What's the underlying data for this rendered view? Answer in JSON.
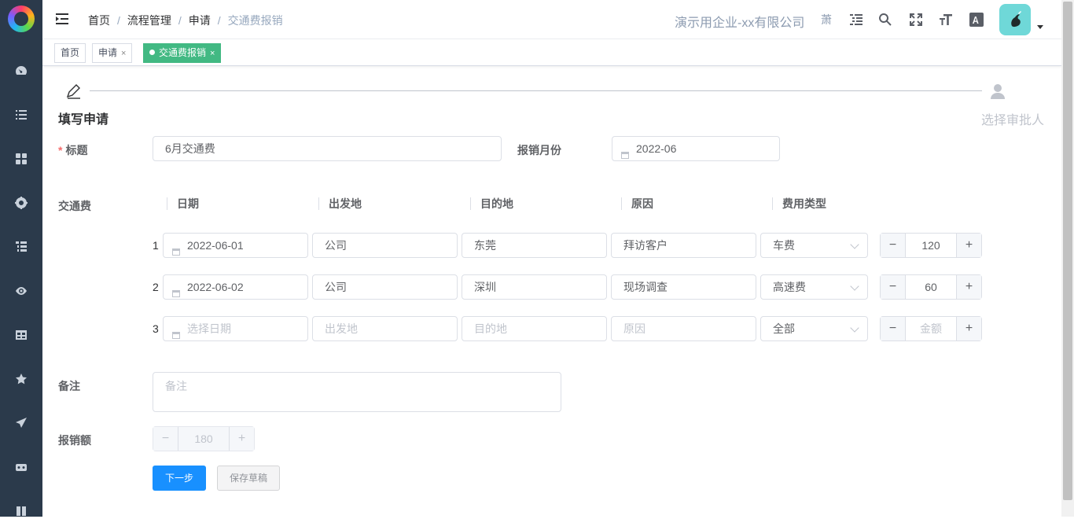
{
  "breadcrumb": [
    "首页",
    "流程管理",
    "申请",
    "交通费报销"
  ],
  "company": "演示用企业-xx有限公司",
  "header_lang": "萧",
  "tags": [
    {
      "label": "首页"
    },
    {
      "label": "申请",
      "close": "×"
    },
    {
      "label": "交通费报销",
      "close": "×",
      "active": true
    }
  ],
  "steps": {
    "step1": "填写申请",
    "step2": "选择审批人"
  },
  "form": {
    "title_label": "标题",
    "title_required_mark": "*",
    "title_value": "6月交通费",
    "month_label": "报销月份",
    "month_value": "2022-06",
    "transport_label": "交通费",
    "columns": [
      "日期",
      "出发地",
      "目的地",
      "原因",
      "费用类型"
    ],
    "rows": [
      {
        "no": "1",
        "date": "2022-06-01",
        "from": "公司",
        "to": "东莞",
        "reason": "拜访客户",
        "type": "车费",
        "amount": "120"
      },
      {
        "no": "2",
        "date": "2022-06-02",
        "from": "公司",
        "to": "深圳",
        "reason": "现场调查",
        "type": "高速费",
        "amount": "60"
      },
      {
        "no": "3",
        "date_placeholder": "选择日期",
        "from_placeholder": "出发地",
        "to_placeholder": "目的地",
        "reason_placeholder": "原因",
        "type": "全部",
        "amount_placeholder": "金额"
      }
    ],
    "remark_label": "备注",
    "remark_placeholder": "备注",
    "total_label": "报销额",
    "total_value": "180",
    "minus": "−",
    "plus": "+"
  },
  "buttons": {
    "next": "下一步",
    "save_draft": "保存草稿"
  },
  "icons": {
    "sidebar": [
      "dashboard-icon",
      "list-icon",
      "grid-icon",
      "target-icon",
      "tasks-icon",
      "eye-icon",
      "table-icon",
      "star-icon",
      "send-icon",
      "robot-icon",
      "book-icon"
    ],
    "header": [
      "menu-fold-icon",
      "tree-icon",
      "search-icon",
      "fullscreen-icon",
      "font-size-icon",
      "translate-icon"
    ]
  },
  "colors": {
    "sidebar_bg": "#2b3a4b",
    "active_tag": "#42b983",
    "primary": "#1890ff"
  }
}
